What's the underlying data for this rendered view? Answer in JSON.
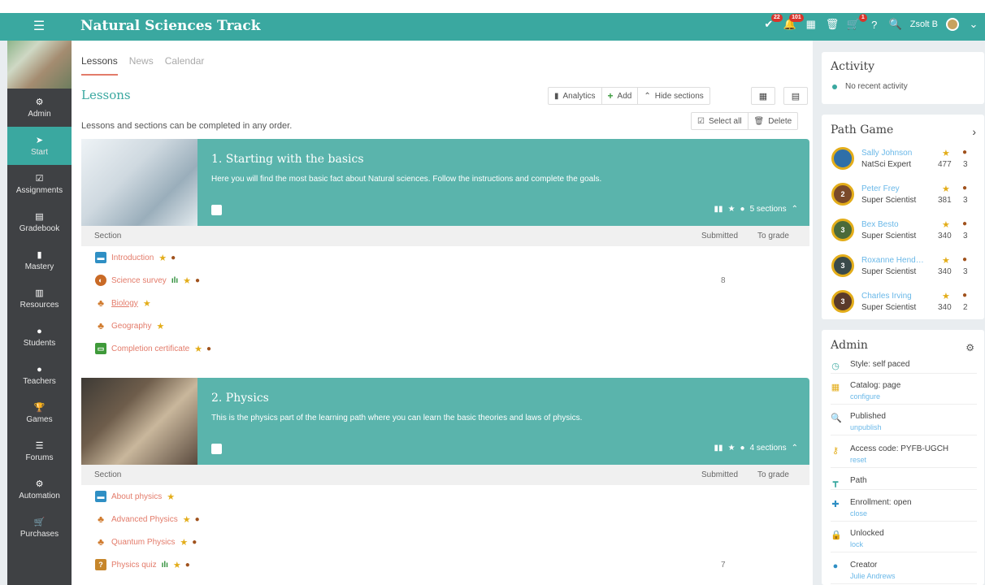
{
  "app": {
    "title": "Natural Sciences Track",
    "user_name": "Zsolt B",
    "badges": {
      "notifications": "22",
      "messages": "101",
      "cart": "1"
    }
  },
  "sidebar": {
    "items": [
      {
        "label": "Admin",
        "icon": "gear-icon"
      },
      {
        "label": "Start",
        "icon": "arrow-icon",
        "active": true
      },
      {
        "label": "Assignments",
        "icon": "checkbox-icon"
      },
      {
        "label": "Gradebook",
        "icon": "gradebook-icon"
      },
      {
        "label": "Mastery",
        "icon": "bar-chart-icon"
      },
      {
        "label": "Resources",
        "icon": "resources-icon"
      },
      {
        "label": "Students",
        "icon": "student-icon"
      },
      {
        "label": "Teachers",
        "icon": "teacher-icon"
      },
      {
        "label": "Games",
        "icon": "trophy-icon"
      },
      {
        "label": "Forums",
        "icon": "forum-icon"
      },
      {
        "label": "Automation",
        "icon": "automation-icon"
      },
      {
        "label": "Purchases",
        "icon": "cart-icon"
      }
    ]
  },
  "main": {
    "tabs": [
      "Lessons",
      "News",
      "Calendar"
    ],
    "heading": "Lessons",
    "toolbar": {
      "analytics": "Analytics",
      "add": "Add",
      "hide_sections": "Hide sections"
    },
    "select_all": "Select all",
    "delete": "Delete",
    "order_note": "Lessons and sections can be completed in any order.",
    "col_section": "Section",
    "col_submitted": "Submitted",
    "col_to_grade": "To grade",
    "lessons": [
      {
        "title": "1. Starting with the basics",
        "description": "Here you will find the most basic fact about Natural sciences. Follow the instructions and complete the goals.",
        "sections_count": "5 sections",
        "sections": [
          {
            "name": "Introduction",
            "submitted": ""
          },
          {
            "name": "Science survey",
            "submitted": "8"
          },
          {
            "name": "Biology",
            "submitted": ""
          },
          {
            "name": "Geography",
            "submitted": ""
          },
          {
            "name": "Completion certificate",
            "submitted": ""
          }
        ]
      },
      {
        "title": "2. Physics",
        "description": "This is the physics part of the learning path where you can learn the basic theories and laws of physics.",
        "sections_count": "4 sections",
        "sections": [
          {
            "name": "About physics",
            "submitted": ""
          },
          {
            "name": "Advanced Physics",
            "submitted": ""
          },
          {
            "name": "Quantum Physics",
            "submitted": ""
          },
          {
            "name": "Physics quiz",
            "submitted": "7"
          }
        ]
      }
    ]
  },
  "activity": {
    "title": "Activity",
    "empty": "No recent activity"
  },
  "path_game": {
    "title": "Path Game",
    "players": [
      {
        "name": "Sally Johnson",
        "rank": "NatSci Expert",
        "score": "477",
        "badges": "3",
        "level": "",
        "color": "#2f6fa8"
      },
      {
        "name": "Peter Frey",
        "rank": "Super Scientist",
        "score": "381",
        "badges": "3",
        "level": "2",
        "color": "#7a4a2a"
      },
      {
        "name": "Bex Besto",
        "rank": "Super Scientist",
        "score": "340",
        "badges": "3",
        "level": "3",
        "color": "#4a6a3a"
      },
      {
        "name": "Roxanne Hende...",
        "rank": "Super Scientist",
        "score": "340",
        "badges": "3",
        "level": "3",
        "color": "#3a4a4a"
      },
      {
        "name": "Charles Irving",
        "rank": "Super Scientist",
        "score": "340",
        "badges": "2",
        "level": "3",
        "color": "#5a3a2a"
      }
    ]
  },
  "admin": {
    "title": "Admin",
    "rows": [
      {
        "icon": "clock-icon",
        "text": "Style: self paced",
        "link": "",
        "color": "#3aa8a0"
      },
      {
        "icon": "catalog-icon",
        "text": "Catalog: page",
        "link": "configure",
        "color": "#e3ad1a"
      },
      {
        "icon": "search-icon",
        "text": "Published",
        "link": "unpublish",
        "color": "#3c9b3f"
      },
      {
        "icon": "key-icon",
        "text": "Access code: PYFB-UGCH",
        "link": "reset",
        "color": "#e3ad1a"
      },
      {
        "icon": "path-icon",
        "text": "Path",
        "link": "",
        "color": "#3aa8a0"
      },
      {
        "icon": "enrollment-icon",
        "text": "Enrollment: open",
        "link": "close",
        "color": "#2f8fc4"
      },
      {
        "icon": "lock-icon",
        "text": "Unlocked",
        "link": "lock",
        "color": "#3c9b3f"
      },
      {
        "icon": "creator-icon",
        "text": "Creator",
        "link": "Julie Andrews",
        "color": "#2f8fc4"
      }
    ]
  }
}
